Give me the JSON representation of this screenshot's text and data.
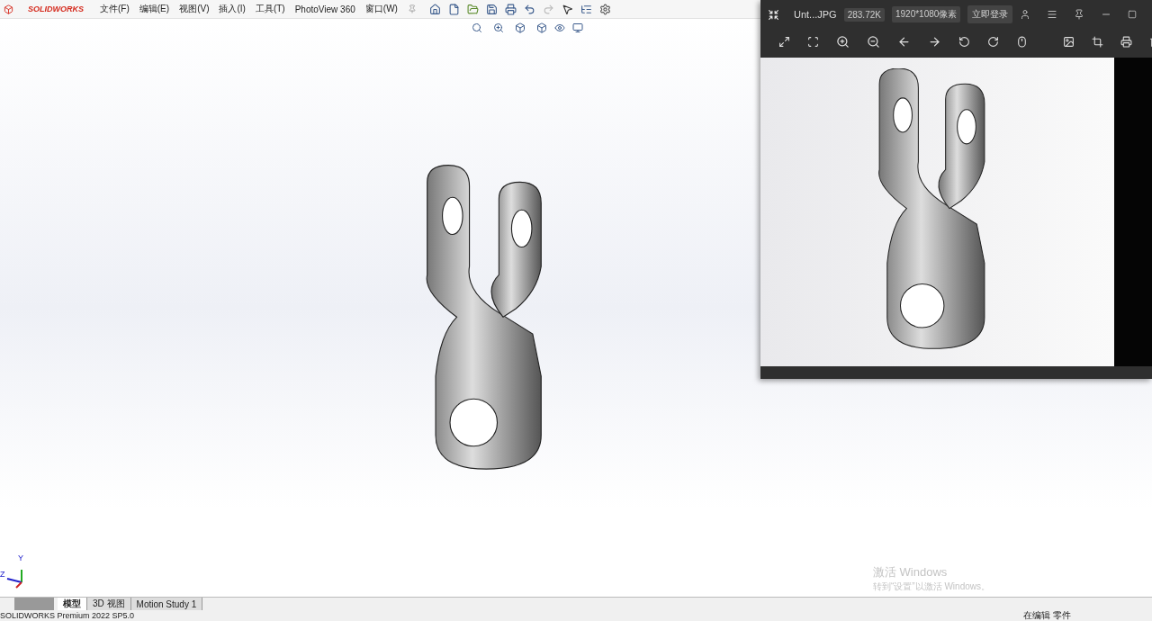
{
  "app": {
    "logo": "SOLIDWORKS",
    "menu": [
      "文件(F)",
      "编辑(E)",
      "视图(V)",
      "插入(I)",
      "工具(T)",
      "PhotoView 360",
      "窗口(W)"
    ]
  },
  "triad": {
    "y_label": "Y",
    "z_label": "Z"
  },
  "tabs": [
    {
      "label": "模型",
      "selected": true
    },
    {
      "label": "3D 视图",
      "selected": false
    },
    {
      "label": "Motion Study 1",
      "selected": false
    }
  ],
  "status_bar": {
    "version": "SOLIDWORKS Premium 2022 SP5.0",
    "mode": "在编辑 零件"
  },
  "activation": {
    "title": "激活 Windows",
    "hint": "转到“设置”以激活 Windows。"
  },
  "viewer": {
    "title": "Unt...JPG",
    "file_size": "283.72K",
    "dimensions": "1920*1080像素",
    "login": "立即登录"
  }
}
